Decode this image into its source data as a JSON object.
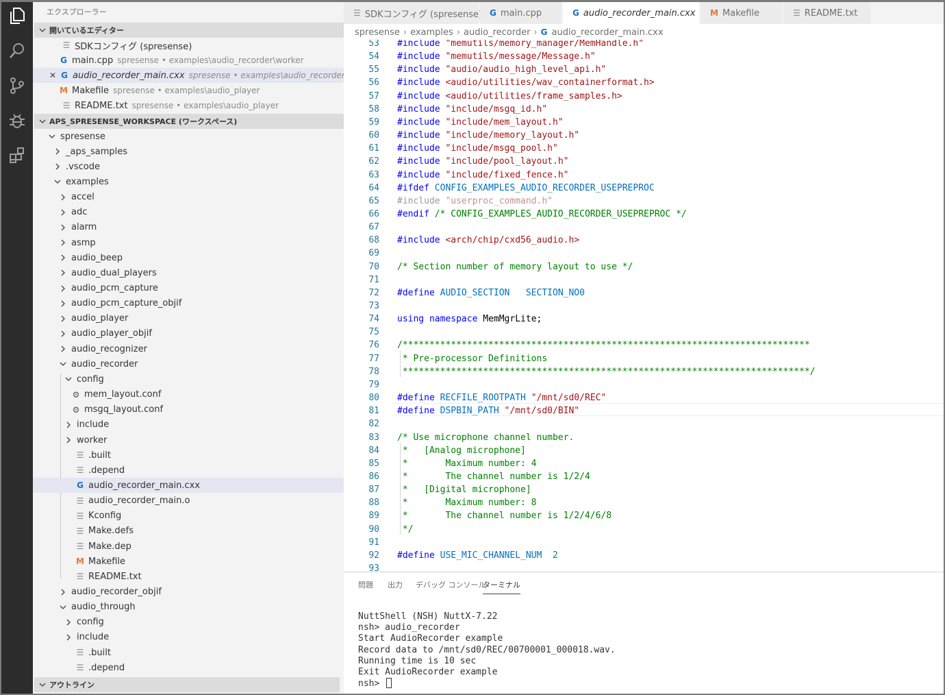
{
  "explorer": {
    "title": "エクスプローラー",
    "open_editors": {
      "header": "開いているエディター",
      "items": [
        {
          "label": "SDKコンフィグ (spresense)",
          "desc": ""
        },
        {
          "label": "main.cpp",
          "desc": "spresense • examples\\audio_recorder\\worker"
        },
        {
          "label": "audio_recorder_main.cxx",
          "desc": "spresense • examples\\audio_recorder"
        },
        {
          "label": "Makefile",
          "desc": "spresense • examples\\audio_player"
        },
        {
          "label": "README.txt",
          "desc": "spresense • examples\\audio_player"
        }
      ]
    },
    "workspace": {
      "header": "APS_SPRESENSE_WORKSPACE (ワークスペース)",
      "tree": [
        "spresense",
        "_aps_samples",
        ".vscode",
        "examples",
        "accel",
        "adc",
        "alarm",
        "asmp",
        "audio_beep",
        "audio_dual_players",
        "audio_pcm_capture",
        "audio_pcm_capture_objif",
        "audio_player",
        "audio_player_objif",
        "audio_recognizer",
        "audio_recorder",
        "config",
        "mem_layout.conf",
        "msgq_layout.conf",
        "include",
        "worker",
        ".built",
        ".depend",
        "audio_recorder_main.cxx",
        "audio_recorder_main.o",
        "Kconfig",
        "Make.defs",
        "Make.dep",
        "Makefile",
        "README.txt",
        "audio_recorder_objif",
        "audio_through",
        "config",
        "include",
        ".built",
        ".depend"
      ]
    },
    "outline_header": "アウトライン"
  },
  "tabs": [
    {
      "label": "SDKコンフィグ (spresense)"
    },
    {
      "label": "main.cpp"
    },
    {
      "label": "audio_recorder_main.cxx"
    },
    {
      "label": "Makefile"
    },
    {
      "label": "README.txt"
    }
  ],
  "breadcrumb": [
    "spresense",
    "examples",
    "audio_recorder",
    "audio_recorder_main.cxx"
  ],
  "editor": {
    "line_numbers": [
      "53",
      "54",
      "55",
      "56",
      "57",
      "58",
      "59",
      "60",
      "61",
      "62",
      "63",
      "64",
      "65",
      "66",
      "67",
      "68",
      "69",
      "70",
      "71",
      "72",
      "73",
      "74",
      "75",
      "76",
      "77",
      "78",
      "79",
      "80",
      "81",
      "82",
      "83",
      "84",
      "85",
      "86",
      "87",
      "88",
      "89",
      "90",
      "91",
      "92",
      "93"
    ],
    "code": {
      "l53": "\"memutils/memory_manager/MemHandle.h\"",
      "l54": "\"memutils/message/Message.h\"",
      "l55": "\"audio/audio_high_level_api.h\"",
      "l56": "<audio/utilities/wav_containerformat.h>",
      "l57": "<audio/utilities/frame_samples.h>",
      "l58": "\"include/msgq_id.h\"",
      "l59": "\"include/mem_layout.h\"",
      "l60": "\"include/memory_layout.h\"",
      "l61": "\"include/msgq_pool.h\"",
      "l62": "\"include/pool_layout.h\"",
      "l63": "\"include/fixed_fence.h\"",
      "l64": "CONFIG_EXAMPLES_AUDIO_RECORDER_USEPREPROC",
      "l65": "\"userproc_command.h\"",
      "l66": "/* CONFIG_EXAMPLES_AUDIO_RECORDER_USEPREPROC */",
      "l68": "<arch/chip/cxd56_audio.h>",
      "l70": "/* Section number of memory layout to use */",
      "l72a": "AUDIO_SECTION",
      "l72b": "SECTION_NO0",
      "l74": "MemMgrLite;",
      "l76": "/****************************************************************************",
      "l77": " * Pre-processor Definitions",
      "l78": " ****************************************************************************/",
      "l80a": "RECFILE_ROOTPATH",
      "l80b": "\"/mnt/sd0/REC\"",
      "l81a": "DSPBIN_PATH",
      "l81b": "\"/mnt/sd0/BIN\"",
      "l83": "/* Use microphone channel number.",
      "l84": " *   [Analog microphone]",
      "l85": " *       Maximum number: 4",
      "l86": " *       The channel number is 1/2/4",
      "l87": " *   [Digital microphone]",
      "l88": " *       Maximum number: 8",
      "l89": " *       The channel number is 1/2/4/6/8",
      "l90": " */",
      "l92a": "USE_MIC_CHANNEL_NUM",
      "l92b": "2"
    },
    "keywords": {
      "include": "#include",
      "ifdef": "#ifdef",
      "endif": "#endif",
      "define": "#define",
      "using": "using",
      "namespace": "namespace"
    }
  },
  "panel": {
    "tabs": [
      "問題",
      "出力",
      "デバッグ コンソール",
      "ターミナル"
    ],
    "terminal": [
      "NuttShell (NSH) NuttX-7.22",
      "nsh> audio_recorder",
      "Start AudioRecorder example",
      "Record data to /mnt/sd0/REC/00700001_000018.wav.",
      "Running time is 10 sec",
      "Exit AudioRecorder example",
      "nsh> "
    ]
  },
  "icons": {
    "files": "files-icon",
    "search": "search-icon",
    "source_control": "source-control-icon",
    "debug": "debug-icon",
    "extensions": "extensions-icon"
  }
}
